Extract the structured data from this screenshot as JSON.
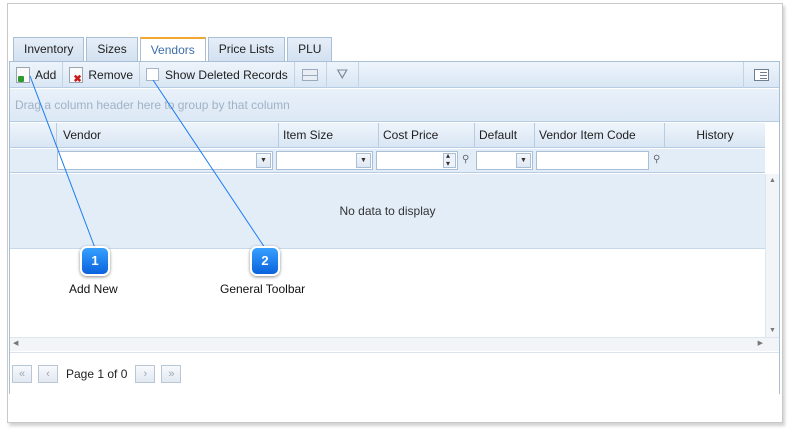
{
  "tabs": [
    "Inventory",
    "Sizes",
    "Vendors",
    "Price Lists",
    "PLU"
  ],
  "active_tab": "Vendors",
  "toolbar": {
    "add_label": "Add",
    "remove_label": "Remove",
    "show_deleted_label": "Show Deleted Records",
    "icons": [
      "add-icon",
      "remove-icon",
      "column-chooser-icon",
      "filter-icon",
      "list-view-icon"
    ]
  },
  "group_panel": {
    "hint": "Drag a column header here to group by that column"
  },
  "columns": [
    "Vendor",
    "Item Size",
    "Cost Price",
    "Default",
    "Vendor Item Code",
    "History"
  ],
  "grid": {
    "empty_text": "No data to display"
  },
  "pager": {
    "page_text": "Page 1 of 0"
  },
  "callouts": [
    {
      "number": "1",
      "label": "Add New"
    },
    {
      "number": "2",
      "label": "General Toolbar"
    }
  ],
  "colors": {
    "callout": "#1a7cf0",
    "active_tab_accent": "#f0a830",
    "header_bg": "#dce8f5"
  }
}
